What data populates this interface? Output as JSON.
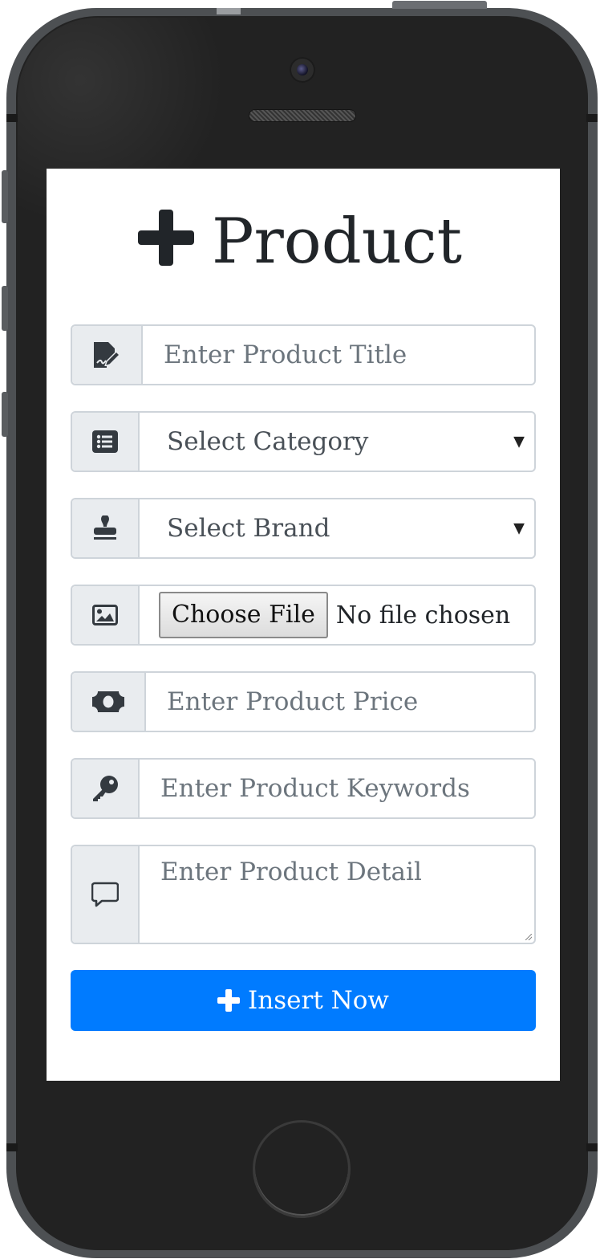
{
  "form": {
    "heading": "Product",
    "title_placeholder": "Enter Product Title",
    "category_select": "Select Category",
    "brand_select": "Select Brand",
    "file_button": "Choose File",
    "file_status": "No file chosen",
    "price_placeholder": "Enter Product Price",
    "keywords_placeholder": "Enter Product Keywords",
    "detail_placeholder": "Enter Product Detail",
    "submit_label": "Insert Now"
  },
  "icons": {
    "heading": "plus-icon",
    "title": "signature-icon",
    "category": "list-icon",
    "brand": "stamp-icon",
    "image": "image-icon",
    "price": "money-bill-icon",
    "keywords": "key-icon",
    "detail": "comment-icon",
    "submit": "plus-icon"
  },
  "colors": {
    "primary": "#007bff",
    "addon_bg": "#e9ecef",
    "border": "#ced4da",
    "placeholder": "#6c757d",
    "phone_body": "#222222"
  }
}
